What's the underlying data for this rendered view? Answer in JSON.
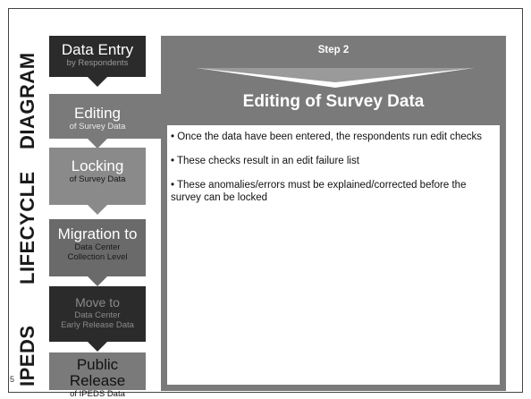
{
  "side_labels": [
    "DIAGRAM",
    "LIFECYCLE",
    "IPEDS"
  ],
  "stages": [
    {
      "title": "Data Entry",
      "subtitle": "by Respondents"
    },
    {
      "title": "Editing",
      "subtitle": "of Survey Data"
    },
    {
      "title": "Locking",
      "subtitle": "of Survey Data"
    },
    {
      "title": "Migration to",
      "subtitle_lines": [
        "Data Center",
        "Collection Level"
      ]
    },
    {
      "title": "Move to",
      "subtitle_lines": [
        "Data Center",
        "Early Release Data"
      ]
    },
    {
      "title": "Public Release",
      "subtitle": "of IPEDS Data"
    }
  ],
  "step": {
    "label": "Step 2",
    "heading": "Editing of Survey Data",
    "bullets": [
      "Once the data have been entered, the respondents run edit checks",
      "These checks result in an edit failure list",
      "These anomalies/errors must be explained/corrected before the survey can be locked"
    ]
  },
  "page_number": "5",
  "colors": {
    "dark": "#2b2b2b",
    "panel": "#7a7a7a",
    "mid": "#6a6a6a",
    "arrow_light": "#8a8a8a",
    "arrow_dark": "#3a3a3a"
  }
}
